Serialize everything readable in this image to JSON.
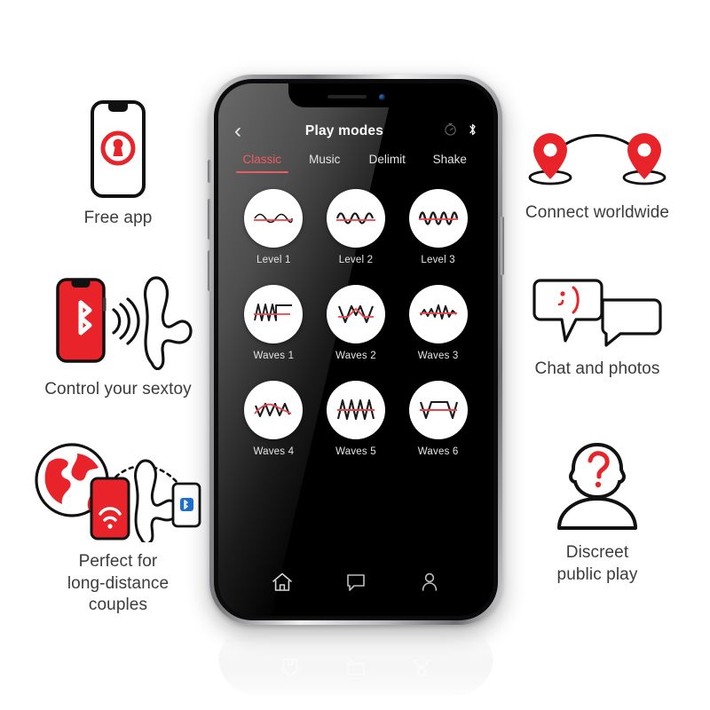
{
  "features_left": [
    {
      "id": "free-app",
      "icon": "phone-lock-icon",
      "caption": "Free app"
    },
    {
      "id": "control-sextoy",
      "icon": "phone-bluetooth-toy-icon",
      "caption": "Control your sextoy"
    },
    {
      "id": "long-distance",
      "icon": "globe-phone-toy-icon",
      "caption": "Perfect for\nlong-distance\ncouples"
    }
  ],
  "features_right": [
    {
      "id": "connect-worldwide",
      "icon": "map-pins-arc-icon",
      "caption": "Connect worldwide"
    },
    {
      "id": "chat-photos",
      "icon": "speech-bubbles-wink-icon",
      "caption": "Chat and photos"
    },
    {
      "id": "discreet-play",
      "icon": "anonymous-person-icon",
      "caption": "Discreet\npublic play"
    }
  ],
  "phone": {
    "app": {
      "header": {
        "back_label": "‹",
        "title": "Play modes",
        "icons": [
          {
            "name": "timer-icon",
            "label": "timer"
          },
          {
            "name": "bluetooth-icon",
            "label": "bluetooth"
          }
        ]
      },
      "tabs": [
        {
          "label": "Classic",
          "active": true
        },
        {
          "label": "Music",
          "active": false
        },
        {
          "label": "Delimit",
          "active": false
        },
        {
          "label": "Shake",
          "active": false
        }
      ],
      "modes": [
        {
          "label": "Level 1",
          "icon": "waveform-level-1-icon"
        },
        {
          "label": "Level 2",
          "icon": "waveform-level-2-icon"
        },
        {
          "label": "Level 3",
          "icon": "waveform-level-3-icon"
        },
        {
          "label": "Waves 1",
          "icon": "waveform-waves-1-icon"
        },
        {
          "label": "Waves 2",
          "icon": "waveform-waves-2-icon"
        },
        {
          "label": "Waves 3",
          "icon": "waveform-waves-3-icon"
        },
        {
          "label": "Waves 4",
          "icon": "waveform-waves-4-icon"
        },
        {
          "label": "Waves 5",
          "icon": "waveform-waves-5-icon"
        },
        {
          "label": "Waves 6",
          "icon": "waveform-waves-6-icon"
        }
      ],
      "bottom_nav": [
        {
          "name": "home-icon",
          "label": "Home"
        },
        {
          "name": "chat-icon",
          "label": "Chat"
        },
        {
          "name": "profile-icon",
          "label": "Profile"
        }
      ]
    }
  },
  "colors": {
    "accent_red": "#e8232a",
    "tab_active": "#ef5d61",
    "caption_text": "#3b3b3b",
    "screen_bg": "#000000",
    "disc_bg": "#ffffff",
    "bluetooth_blue": "#1f6fd0"
  }
}
